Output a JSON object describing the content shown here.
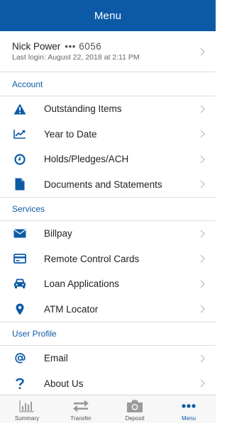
{
  "header": {
    "title": "Menu"
  },
  "user": {
    "name": "Nick Power",
    "account_masked": "••• 6056",
    "last_login": "Last login: August 22, 2018 at 2:11 PM"
  },
  "sections": {
    "account": {
      "title": "Account",
      "items": [
        {
          "label": "Outstanding Items",
          "icon": "warning-icon"
        },
        {
          "label": "Year to Date",
          "icon": "trend-chart-icon"
        },
        {
          "label": "Holds/Pledges/ACH",
          "icon": "clock-icon"
        },
        {
          "label": "Documents and Statements",
          "icon": "document-icon"
        }
      ]
    },
    "services": {
      "title": "Services",
      "items": [
        {
          "label": "Billpay",
          "icon": "envelope-icon"
        },
        {
          "label": "Remote Control Cards",
          "icon": "credit-card-icon"
        },
        {
          "label": "Loan Applications",
          "icon": "car-icon"
        },
        {
          "label": "ATM Locator",
          "icon": "map-pin-icon"
        }
      ]
    },
    "user_profile": {
      "title": "User Profile",
      "items": [
        {
          "label": "Email",
          "icon": "at-sign-icon"
        },
        {
          "label": "About Us",
          "icon": "question-icon"
        }
      ]
    }
  },
  "tabbar": {
    "tabs": [
      {
        "label": "Summary",
        "icon": "bar-chart-icon",
        "active": false
      },
      {
        "label": "Transfer",
        "icon": "transfer-arrows-icon",
        "active": false
      },
      {
        "label": "Deposit",
        "icon": "camera-icon",
        "active": false
      },
      {
        "label": "Menu",
        "icon": "more-dots-icon",
        "active": true
      }
    ]
  },
  "colors": {
    "brand": "#0c5aa6",
    "divider": "#dcdcdc",
    "chevron": "#c4c4c4",
    "inactive_tab": "#9a9a9a"
  }
}
